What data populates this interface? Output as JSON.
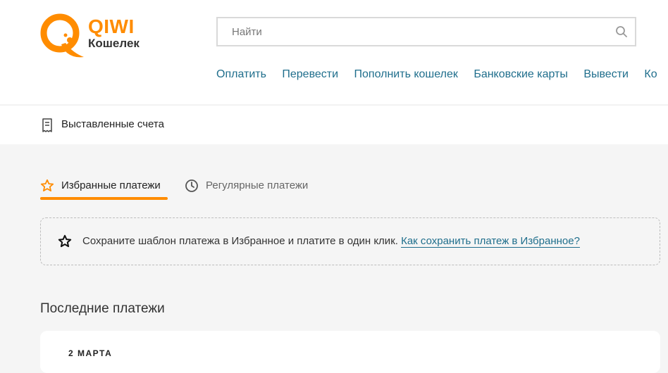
{
  "logo": {
    "brand": "QIWI",
    "subtitle": "Кошелек",
    "brand_color": "#ff8c00"
  },
  "search": {
    "placeholder": "Найти",
    "value": "",
    "icon": "search-icon"
  },
  "nav": {
    "items": [
      {
        "label": "Оплатить"
      },
      {
        "label": "Перевести"
      },
      {
        "label": "Пополнить кошелек"
      },
      {
        "label": "Банковские карты"
      },
      {
        "label": "Вывести"
      },
      {
        "label": "Ко"
      }
    ],
    "color": "#1f6e8c"
  },
  "subbar": {
    "invoices_label": "Выставленные счета",
    "icon": "receipt-icon"
  },
  "tabs": [
    {
      "label": "Избранные платежи",
      "icon": "star-icon",
      "active": true
    },
    {
      "label": "Регулярные платежи",
      "icon": "clock-icon",
      "active": false
    }
  ],
  "info": {
    "text": "Сохраните шаблон платежа в Избранное и платите в один клик.",
    "link": "Как сохранить платеж в Избранное?",
    "icon": "star-icon"
  },
  "recent": {
    "title": "Последние платежи",
    "groups": [
      {
        "date": "2 МАРТА"
      }
    ]
  }
}
